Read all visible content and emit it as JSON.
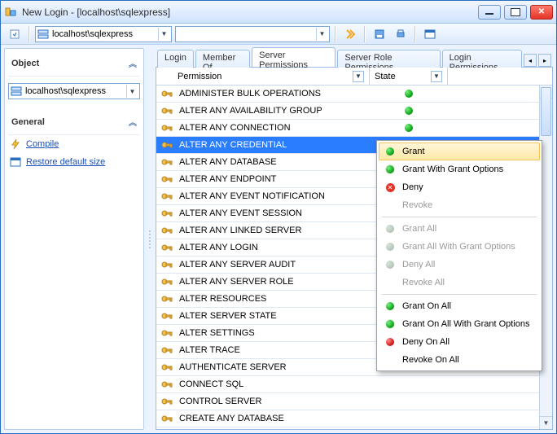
{
  "window": {
    "title": "New Login - [localhost\\sqlexpress]"
  },
  "toolbar": {
    "server": "localhost\\sqlexpress"
  },
  "sidebar": {
    "object_head": "Object",
    "object_value": "localhost\\sqlexpress",
    "general_head": "General",
    "compile": "Compile",
    "restore": "Restore default size"
  },
  "tabs": {
    "login": "Login",
    "member_of": "Member Of",
    "server_permissions": "Server Permissions",
    "server_role_permissions": "Server Role Permissions",
    "login_permissions": "Login Permissions"
  },
  "grid": {
    "col_permission": "Permission",
    "col_state": "State",
    "rows": [
      {
        "name": "ADMINISTER BULK OPERATIONS",
        "state": "grant"
      },
      {
        "name": "ALTER ANY AVAILABILITY GROUP",
        "state": "grant"
      },
      {
        "name": "ALTER ANY CONNECTION",
        "state": "grant"
      },
      {
        "name": "ALTER ANY CREDENTIAL",
        "state": "",
        "selected": true
      },
      {
        "name": "ALTER ANY DATABASE",
        "state": ""
      },
      {
        "name": "ALTER ANY ENDPOINT",
        "state": ""
      },
      {
        "name": "ALTER ANY EVENT NOTIFICATION",
        "state": ""
      },
      {
        "name": "ALTER ANY EVENT SESSION",
        "state": ""
      },
      {
        "name": "ALTER ANY LINKED SERVER",
        "state": ""
      },
      {
        "name": "ALTER ANY LOGIN",
        "state": ""
      },
      {
        "name": "ALTER ANY SERVER AUDIT",
        "state": ""
      },
      {
        "name": "ALTER ANY SERVER ROLE",
        "state": ""
      },
      {
        "name": "ALTER RESOURCES",
        "state": ""
      },
      {
        "name": "ALTER SERVER STATE",
        "state": ""
      },
      {
        "name": "ALTER SETTINGS",
        "state": ""
      },
      {
        "name": "ALTER TRACE",
        "state": ""
      },
      {
        "name": "AUTHENTICATE SERVER",
        "state": ""
      },
      {
        "name": "CONNECT SQL",
        "state": ""
      },
      {
        "name": "CONTROL SERVER",
        "state": ""
      },
      {
        "name": "CREATE ANY DATABASE",
        "state": ""
      }
    ]
  },
  "context_menu": {
    "items": [
      {
        "label": "Grant",
        "icon": "green",
        "hover": true
      },
      {
        "label": "Grant With Grant Options",
        "icon": "grn2"
      },
      {
        "label": "Deny",
        "icon": "denyx"
      },
      {
        "label": "Revoke",
        "icon": "",
        "disabled": true
      },
      {
        "divider": true
      },
      {
        "label": "Grant All",
        "icon": "ghost",
        "disabled": true
      },
      {
        "label": "Grant All With Grant Options",
        "icon": "ghost",
        "disabled": true
      },
      {
        "label": "Deny All",
        "icon": "ghost",
        "disabled": true
      },
      {
        "label": "Revoke All",
        "icon": "",
        "disabled": true
      },
      {
        "divider": true
      },
      {
        "label": "Grant On All",
        "icon": "green"
      },
      {
        "label": "Grant On All With Grant Options",
        "icon": "grn2"
      },
      {
        "label": "Deny On All",
        "icon": "red"
      },
      {
        "label": "Revoke On All",
        "icon": ""
      }
    ]
  }
}
